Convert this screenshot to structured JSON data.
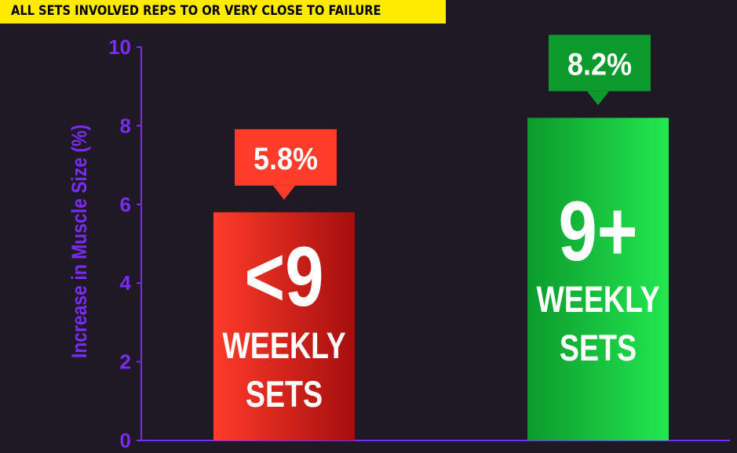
{
  "banner": {
    "text": "ALL SETS INVOLVED REPS TO OR VERY CLOSE TO FAILURE"
  },
  "colors": {
    "background": "#1f1926",
    "axis": "#7a2cf5",
    "banner": "#ffea00",
    "red_light": "#ff3b2a",
    "red_dark": "#a50e0e",
    "green_light": "#22e850",
    "green_dark": "#0c9a2c"
  },
  "chart_data": {
    "type": "bar",
    "ylabel": "Increase in Muscle Size (%)",
    "xlabel": "",
    "ylim": [
      0,
      10
    ],
    "yticks": [
      "0",
      "2",
      "4",
      "6",
      "8",
      "10"
    ],
    "grid": false,
    "categories": [
      "<9 WEEKLY SETS",
      "9+ WEEKLY SETS"
    ],
    "values": [
      5.8,
      8.2
    ],
    "bars": [
      {
        "big": "<9",
        "line1": "WEEKLY",
        "line2": "SETS",
        "callout": "5.8%",
        "color": "red"
      },
      {
        "big": "9+",
        "line1": "WEEKLY",
        "line2": "SETS",
        "callout": "8.2%",
        "color": "green"
      }
    ]
  }
}
